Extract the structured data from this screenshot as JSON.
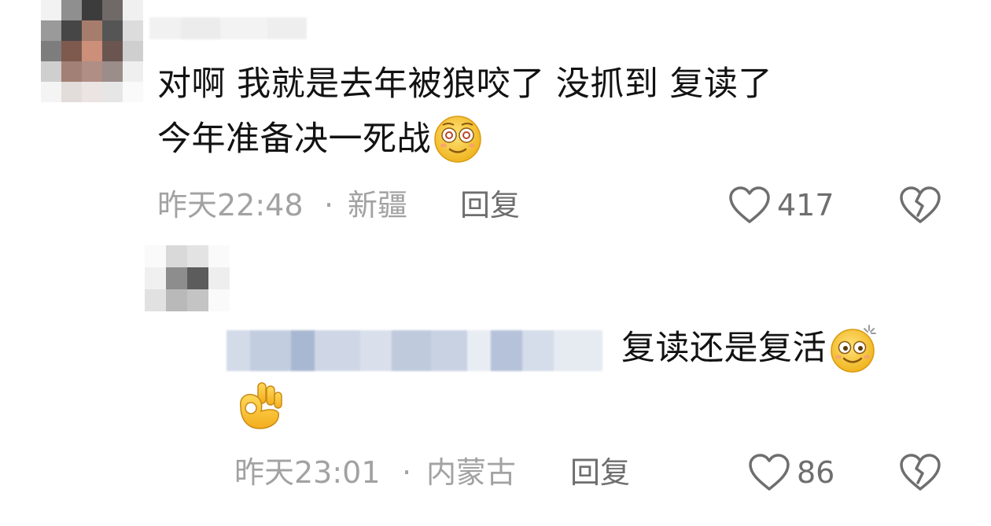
{
  "comment": {
    "text_line1": "对啊  我就是去年被狼咬了  没抓到  复读了",
    "text_line2": "今年准备决一死战",
    "emoji_icon": "dazed-face-emoji",
    "time": "昨天22:48",
    "separator": "·",
    "location": "新疆",
    "reply_label": "回复",
    "like_count": "417"
  },
  "reply": {
    "text": "复读还是复活",
    "emoji_icon": "dizzy-smiling-emoji",
    "extra_icon": "ok-hand-emoji",
    "time": "昨天23:01",
    "separator": "·",
    "location": "内蒙古",
    "reply_label": "回复",
    "like_count": "86"
  },
  "colors": {
    "text": "#121212",
    "meta": "#a2a2a2",
    "action": "#6e6e6e",
    "emoji_yellow": "#f6c32c"
  }
}
